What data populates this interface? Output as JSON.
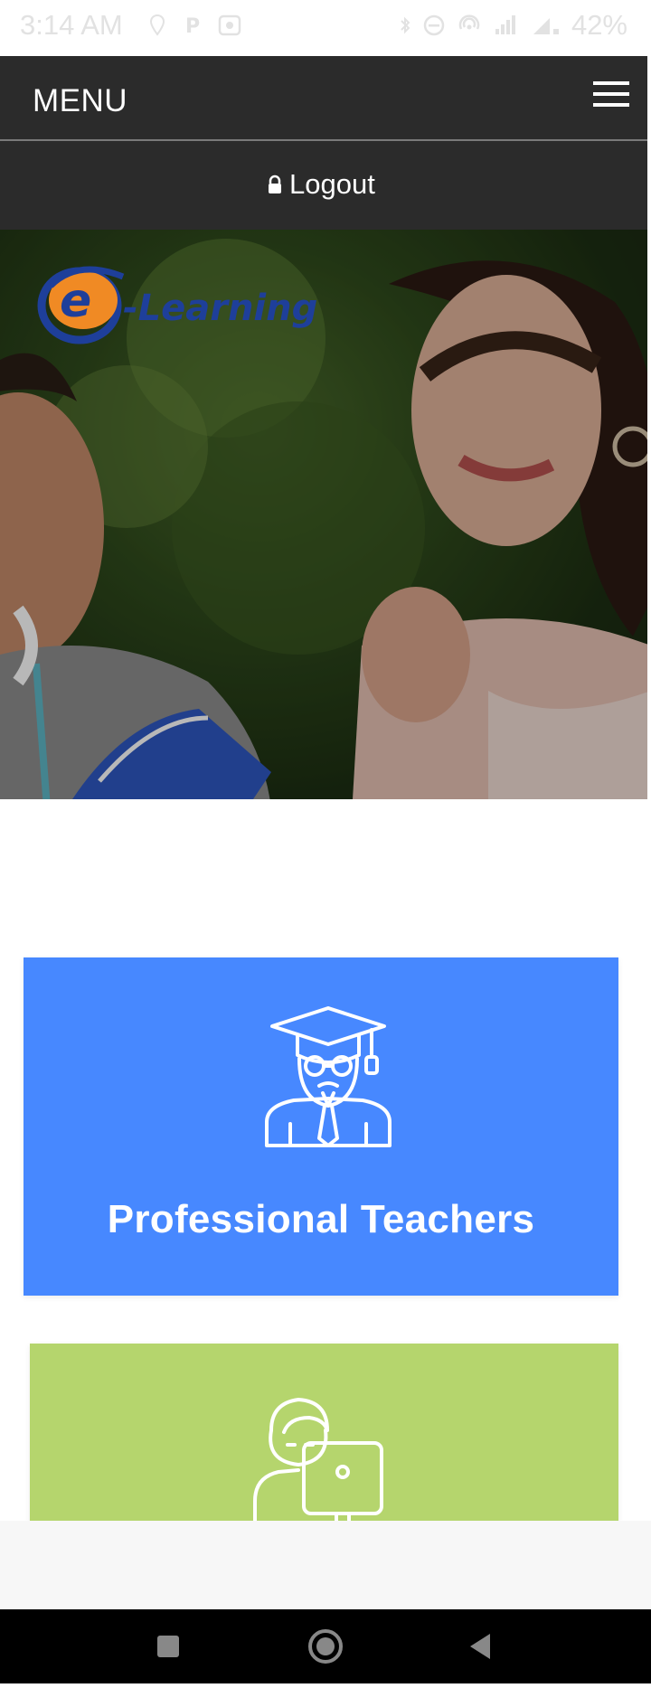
{
  "status_bar": {
    "time": "3:14 AM",
    "battery": "42%",
    "left_icons": [
      "location-icon",
      "p-icon",
      "screenshot-icon"
    ],
    "right_icons": [
      "bluetooth-icon",
      "dnd-icon",
      "hotspot-icon",
      "signal-icon",
      "data-icon"
    ]
  },
  "header": {
    "menu_label": "MENU",
    "logout_label": "Logout"
  },
  "hero": {
    "logo_letter": "e",
    "logo_text": "-Learning"
  },
  "cards": [
    {
      "title": "Professional Teachers",
      "icon": "teacher-icon",
      "color": "#4788ff"
    },
    {
      "title": "",
      "icon": "student-computer-icon",
      "color": "#b5d56d"
    }
  ],
  "colors": {
    "app_bar": "#2b2b2b",
    "blue_card": "#4788ff",
    "green_card": "#b5d56d",
    "logo_orange": "#f08a24",
    "logo_blue": "#1e3f9a"
  }
}
